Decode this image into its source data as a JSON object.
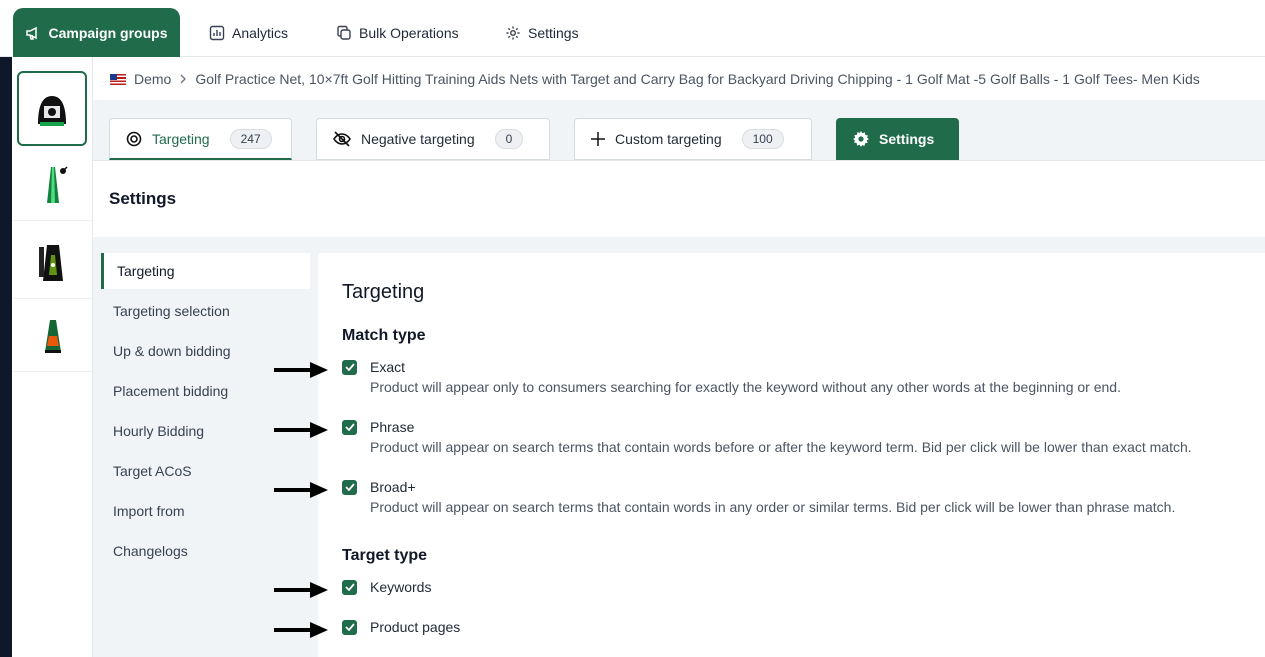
{
  "topnav": {
    "campaign_groups": "Campaign groups",
    "analytics": "Analytics",
    "bulk_operations": "Bulk Operations",
    "settings": "Settings"
  },
  "breadcrumb": {
    "account": "Demo",
    "product": "Golf Practice Net, 10×7ft Golf Hitting Training Aids Nets with Target and Carry Bag for Backyard Driving Chipping - 1 Golf Mat -5 Golf Balls - 1 Golf Tees- Men Kids"
  },
  "subtabs": {
    "targeting": {
      "label": "Targeting",
      "count": "247"
    },
    "negative": {
      "label": "Negative targeting",
      "count": "0"
    },
    "custom": {
      "label": "Custom targeting",
      "count": "100"
    },
    "settings": {
      "label": "Settings"
    }
  },
  "page_title": "Settings",
  "menu": [
    "Targeting",
    "Targeting selection",
    "Up & down bidding",
    "Placement bidding",
    "Hourly Bidding",
    "Target ACoS",
    "Import from",
    "Changelogs"
  ],
  "content": {
    "title": "Targeting",
    "match_type_heading": "Match type",
    "match_types": [
      {
        "label": "Exact",
        "checked": true,
        "desc": "Product will appear only to consumers searching for exactly the keyword without any other words at the beginning or end."
      },
      {
        "label": "Phrase",
        "checked": true,
        "desc": "Product will appear on search terms that contain words before or after the keyword term. Bid per click will be lower than exact match."
      },
      {
        "label": "Broad+",
        "checked": true,
        "desc": "Product will appear on search terms that contain words in any order or similar terms. Bid per click will be lower than phrase match."
      }
    ],
    "target_type_heading": "Target type",
    "target_types": [
      {
        "label": "Keywords",
        "checked": true
      },
      {
        "label": "Product pages",
        "checked": true
      }
    ]
  },
  "colors": {
    "accent": "#1f6b4a",
    "panel": "#f1f4f7"
  }
}
